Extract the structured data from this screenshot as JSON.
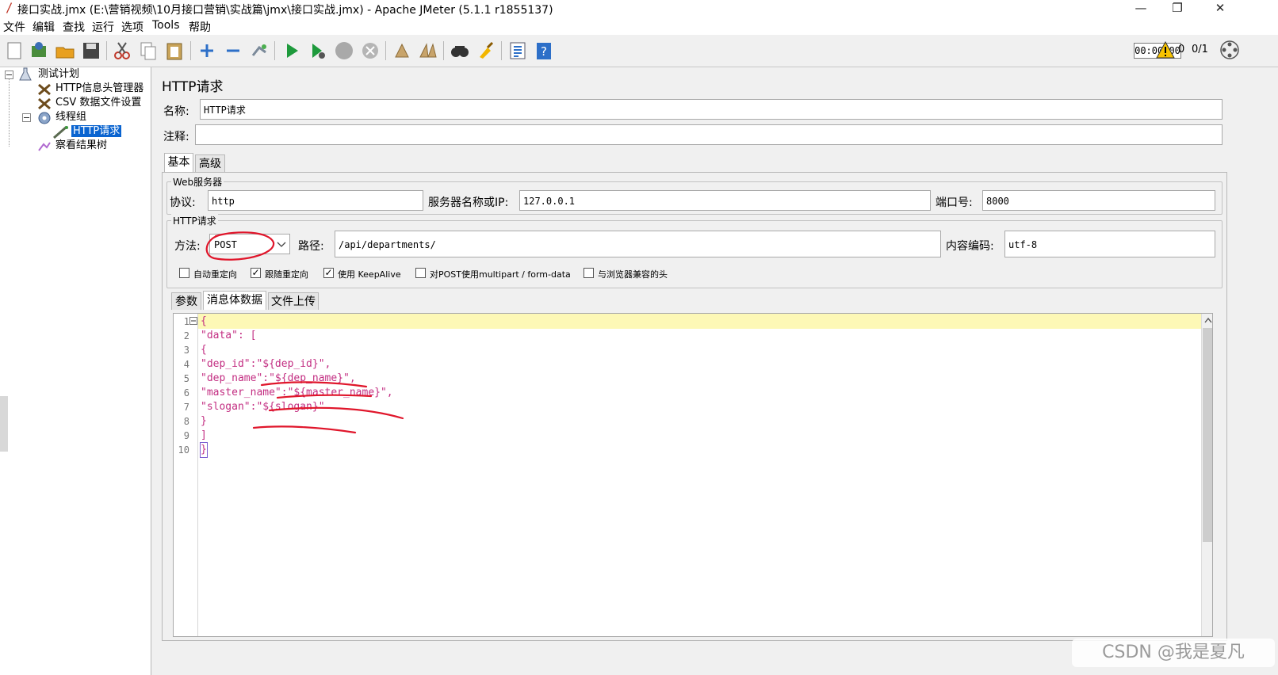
{
  "window": {
    "title": "接口实战.jmx (E:\\营销视频\\10月接口营销\\实战篇\\jmx\\接口实战.jmx) - Apache JMeter (5.1.1 r1855137)",
    "minimize": "—",
    "maximize": "❐",
    "close": "✕"
  },
  "menu": [
    "文件",
    "编辑",
    "查找",
    "运行",
    "选项",
    "Tools",
    "帮助"
  ],
  "toolbar": {
    "timer": "00:00:00",
    "warning_count": "0",
    "threads": "0/1"
  },
  "tree": {
    "root": "测试计划",
    "items": [
      {
        "label": "HTTP信息头管理器",
        "icon": "tool-icon"
      },
      {
        "label": "CSV 数据文件设置",
        "icon": "tool-icon"
      },
      {
        "label": "线程组",
        "icon": "gear-icon"
      },
      {
        "label": "HTTP请求",
        "icon": "sampler-icon",
        "selected": true
      },
      {
        "label": "察看结果树",
        "icon": "listener-icon"
      }
    ]
  },
  "panel": {
    "title": "HTTP请求",
    "name_label": "名称:",
    "name_value": "HTTP请求",
    "comment_label": "注释:",
    "comment_value": "",
    "tabs": [
      "基本",
      "高级"
    ],
    "web_server": {
      "legend": "Web服务器",
      "protocol_label": "协议:",
      "protocol_value": "http",
      "server_label": "服务器名称或IP:",
      "server_value": "127.0.0.1",
      "port_label": "端口号:",
      "port_value": "8000"
    },
    "http_request": {
      "legend": "HTTP请求",
      "method_label": "方法:",
      "method_value": "POST",
      "path_label": "路径:",
      "path_value": "/api/departments/",
      "encoding_label": "内容编码:",
      "encoding_value": "utf-8",
      "checkboxes": [
        {
          "label": "自动重定向",
          "checked": false
        },
        {
          "label": "跟随重定向",
          "checked": true
        },
        {
          "label": "使用 KeepAlive",
          "checked": true
        },
        {
          "label": "对POST使用multipart / form-data",
          "checked": false
        },
        {
          "label": "与浏览器兼容的头",
          "checked": false
        }
      ],
      "subtabs": [
        "参数",
        "消息体数据",
        "文件上传"
      ]
    },
    "body_lines": [
      "{",
      "\"data\": [",
      "{",
      "\"dep_id\":\"${dep_id}\",",
      "\"dep_name\":\"${dep_name}\",",
      "\"master_name\":\"${master_name}\",",
      "\"slogan\":\"${slogan}\"",
      "}",
      "]",
      "}"
    ],
    "line_numbers": [
      "1",
      "2",
      "3",
      "4",
      "5",
      "6",
      "7",
      "8",
      "9",
      "10"
    ]
  },
  "watermark": "CSDN @我是夏凡",
  "colors": {
    "code": "#c32e82",
    "selection": "#0a64d0",
    "annotation": "#e0162b",
    "current_line": "#fdf8b6"
  }
}
